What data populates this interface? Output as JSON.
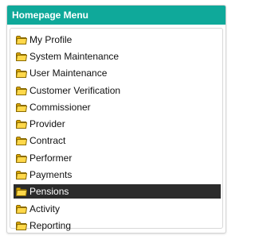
{
  "panel": {
    "title": "Homepage Menu",
    "header_color": "#0fa99a"
  },
  "menu": {
    "items": [
      {
        "label": "My Profile",
        "icon": "folder-icon",
        "selected": false
      },
      {
        "label": "System Maintenance",
        "icon": "folder-icon",
        "selected": false
      },
      {
        "label": "User Maintenance",
        "icon": "folder-icon",
        "selected": false
      },
      {
        "label": "Customer Verification",
        "icon": "folder-icon",
        "selected": false
      },
      {
        "label": "Commissioner",
        "icon": "folder-icon",
        "selected": false
      },
      {
        "label": "Provider",
        "icon": "folder-icon",
        "selected": false
      },
      {
        "label": "Contract",
        "icon": "folder-icon",
        "selected": false
      },
      {
        "label": "Performer",
        "icon": "folder-icon",
        "selected": false
      },
      {
        "label": "Payments",
        "icon": "folder-icon",
        "selected": false
      },
      {
        "label": "Pensions",
        "icon": "folder-icon",
        "selected": true
      },
      {
        "label": "Activity",
        "icon": "folder-icon",
        "selected": false
      },
      {
        "label": "Reporting",
        "icon": "folder-icon",
        "selected": false
      }
    ],
    "selected_color": "#2b2b2b"
  }
}
